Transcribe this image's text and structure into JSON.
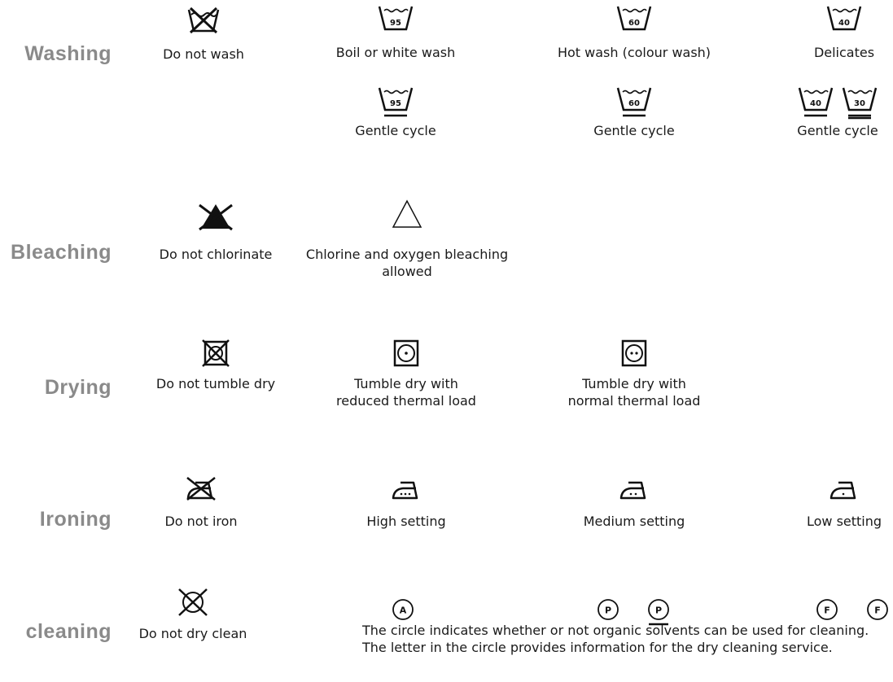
{
  "categories": {
    "washing": "Washing",
    "bleaching": "Bleaching",
    "drying": "Drying",
    "ironing": "Ironing",
    "cleaning": "cleaning"
  },
  "washing": {
    "do_not_wash": "Do not wash",
    "boil": {
      "caption": "Boil or white wash",
      "temp": "95"
    },
    "hot": {
      "caption": "Hot wash (colour wash)",
      "temp": "60"
    },
    "delicates": {
      "caption": "Delicates",
      "temp": "40"
    },
    "gentle_95": {
      "caption": "Gentle cycle",
      "temp": "95"
    },
    "gentle_60": {
      "caption": "Gentle cycle",
      "temp": "60"
    },
    "gentle_40_30": {
      "caption": "Gentle cycle",
      "temp_a": "40",
      "temp_b": "30"
    }
  },
  "bleaching": {
    "do_not_chlorinate": "Do not chlorinate",
    "allowed_line1": "Chlorine and oxygen bleaching",
    "allowed_line2": "allowed"
  },
  "drying": {
    "do_not_tumble": "Do not tumble dry",
    "reduced_line1": "Tumble dry with",
    "reduced_line2": "reduced thermal load",
    "normal_line1": "Tumble dry with",
    "normal_line2": "normal thermal load"
  },
  "ironing": {
    "do_not_iron": "Do not iron",
    "high": "High setting",
    "medium": "Medium setting",
    "low": "Low setting"
  },
  "dry_cleaning": {
    "do_not_dry_clean": "Do not dry clean",
    "letter_a": "A",
    "letter_p": "P",
    "letter_f": "F",
    "note_line1": "The circle indicates whether or not organic solvents can be used for cleaning.",
    "note_line2": "The letter in the circle provides information for the dry cleaning service."
  }
}
